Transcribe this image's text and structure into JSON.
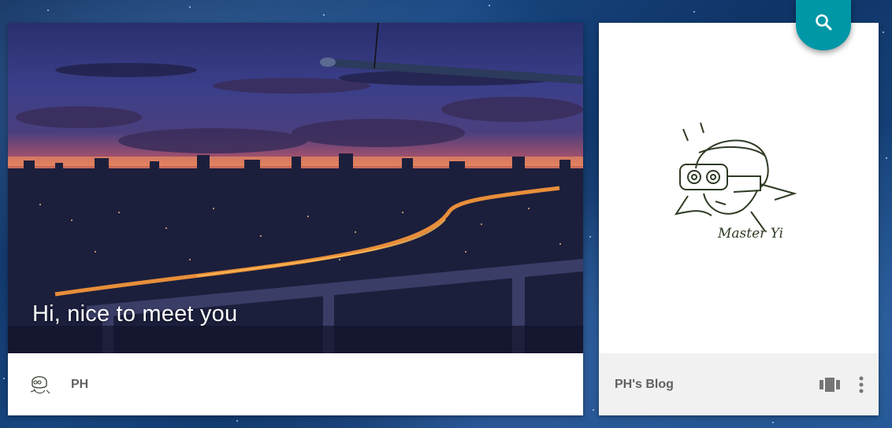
{
  "main_card": {
    "hero_title": "Hi, nice to meet you",
    "author_name": "PH"
  },
  "side_card": {
    "art_caption": "Master Yi",
    "blog_title": "PH's Blog",
    "view_icon": "view-carousel-icon",
    "more_icon": "more-vert-icon"
  },
  "fab": {
    "icon": "search-icon",
    "color": "#0097a7"
  }
}
